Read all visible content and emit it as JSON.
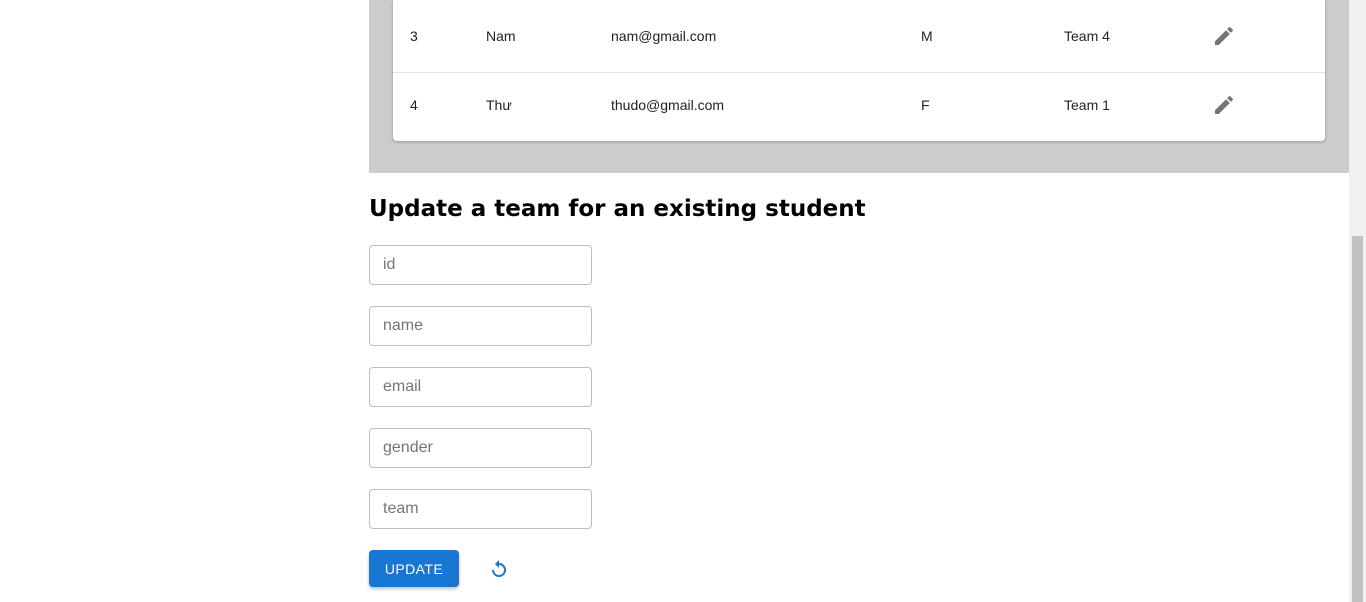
{
  "table": {
    "rows": [
      {
        "id": "3",
        "name": "Nam",
        "email": "nam@gmail.com",
        "gender": "M",
        "team": "Team 4"
      },
      {
        "id": "4",
        "name": "Thư",
        "email": "thudo@gmail.com",
        "gender": "F",
        "team": "Team 1"
      }
    ]
  },
  "form": {
    "title": "Update a team for an existing student",
    "fields": {
      "id": {
        "placeholder": "id",
        "value": ""
      },
      "name": {
        "placeholder": "name",
        "value": ""
      },
      "email": {
        "placeholder": "email",
        "value": ""
      },
      "gender": {
        "placeholder": "gender",
        "value": ""
      },
      "team": {
        "placeholder": "team",
        "value": ""
      }
    },
    "update_label": "UPDATE"
  },
  "icons": {
    "edit": "pencil-icon",
    "reset": "refresh-icon"
  },
  "colors": {
    "primary": "#1976d2",
    "band": "#cccccc",
    "icon_gray": "#757575"
  }
}
